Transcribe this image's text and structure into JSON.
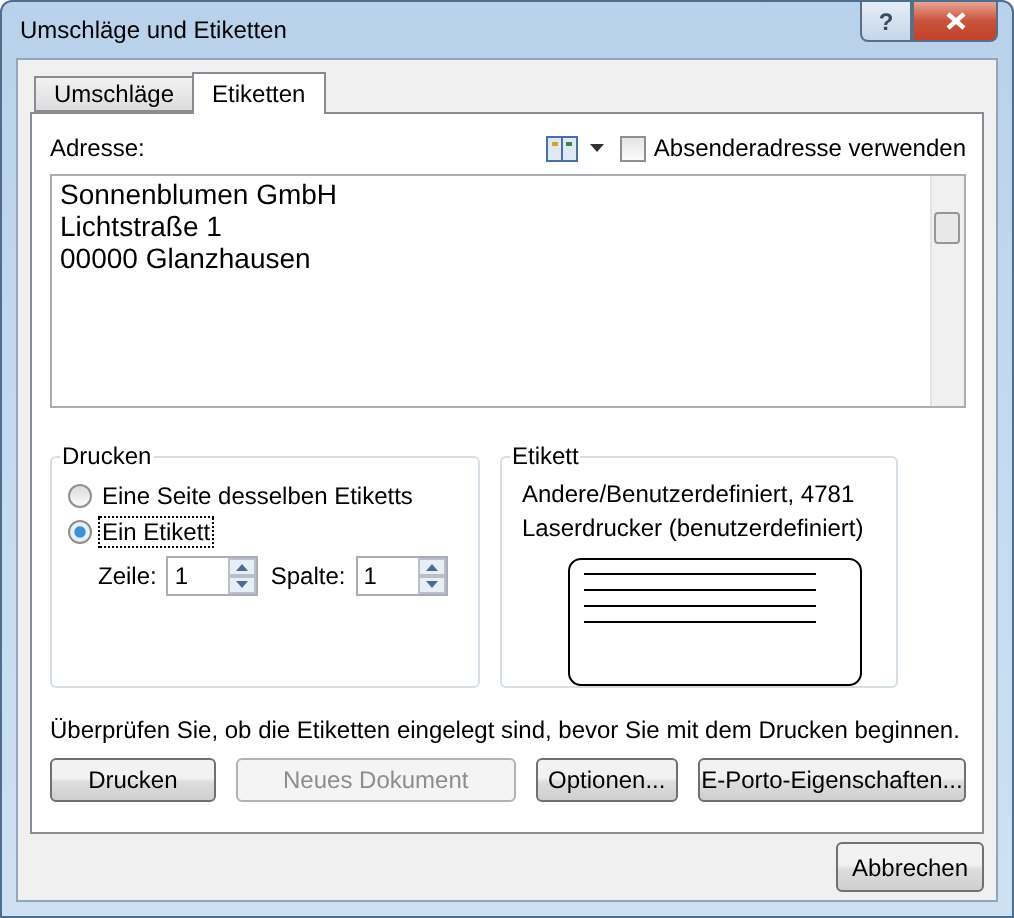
{
  "window": {
    "title": "Umschläge und Etiketten",
    "buttons": [
      {
        "kind": "help",
        "label": "?"
      },
      {
        "kind": "close"
      }
    ]
  },
  "tabs": [
    {
      "label": "Umschläge",
      "selected": false
    },
    {
      "label": "Etiketten",
      "selected": true
    }
  ],
  "address": {
    "label": "Adresse:",
    "lines": [
      "Sonnenblumen GmbH",
      "Lichtstraße 1",
      "00000 Glanzhausen"
    ],
    "use_sender": {
      "label": "Absenderadresse verwenden",
      "checked": false
    }
  },
  "print_group": {
    "title": "Drucken",
    "options": [
      {
        "label": "Eine Seite desselben Etiketts",
        "selected": false
      },
      {
        "label": "Ein Etikett",
        "selected": true
      }
    ],
    "row": {
      "label": "Zeile:",
      "value": "1"
    },
    "column": {
      "label": "Spalte:",
      "value": "1"
    }
  },
  "label_group": {
    "title": "Etikett",
    "lines": [
      "Andere/Benutzerdefiniert, 4781",
      "Laserdrucker (benutzerdefiniert)"
    ]
  },
  "notice": "Überprüfen Sie, ob die Etiketten eingelegt sind, bevor Sie mit dem Drucken beginnen.",
  "actions": [
    {
      "label": "Drucken",
      "disabled": false
    },
    {
      "label": "Neues Dokument",
      "disabled": true
    },
    {
      "label": "Optionen...",
      "disabled": false
    },
    {
      "label": "E-Porto-Eigenschaften...",
      "disabled": false
    }
  ],
  "cancel": "Abbrechen"
}
